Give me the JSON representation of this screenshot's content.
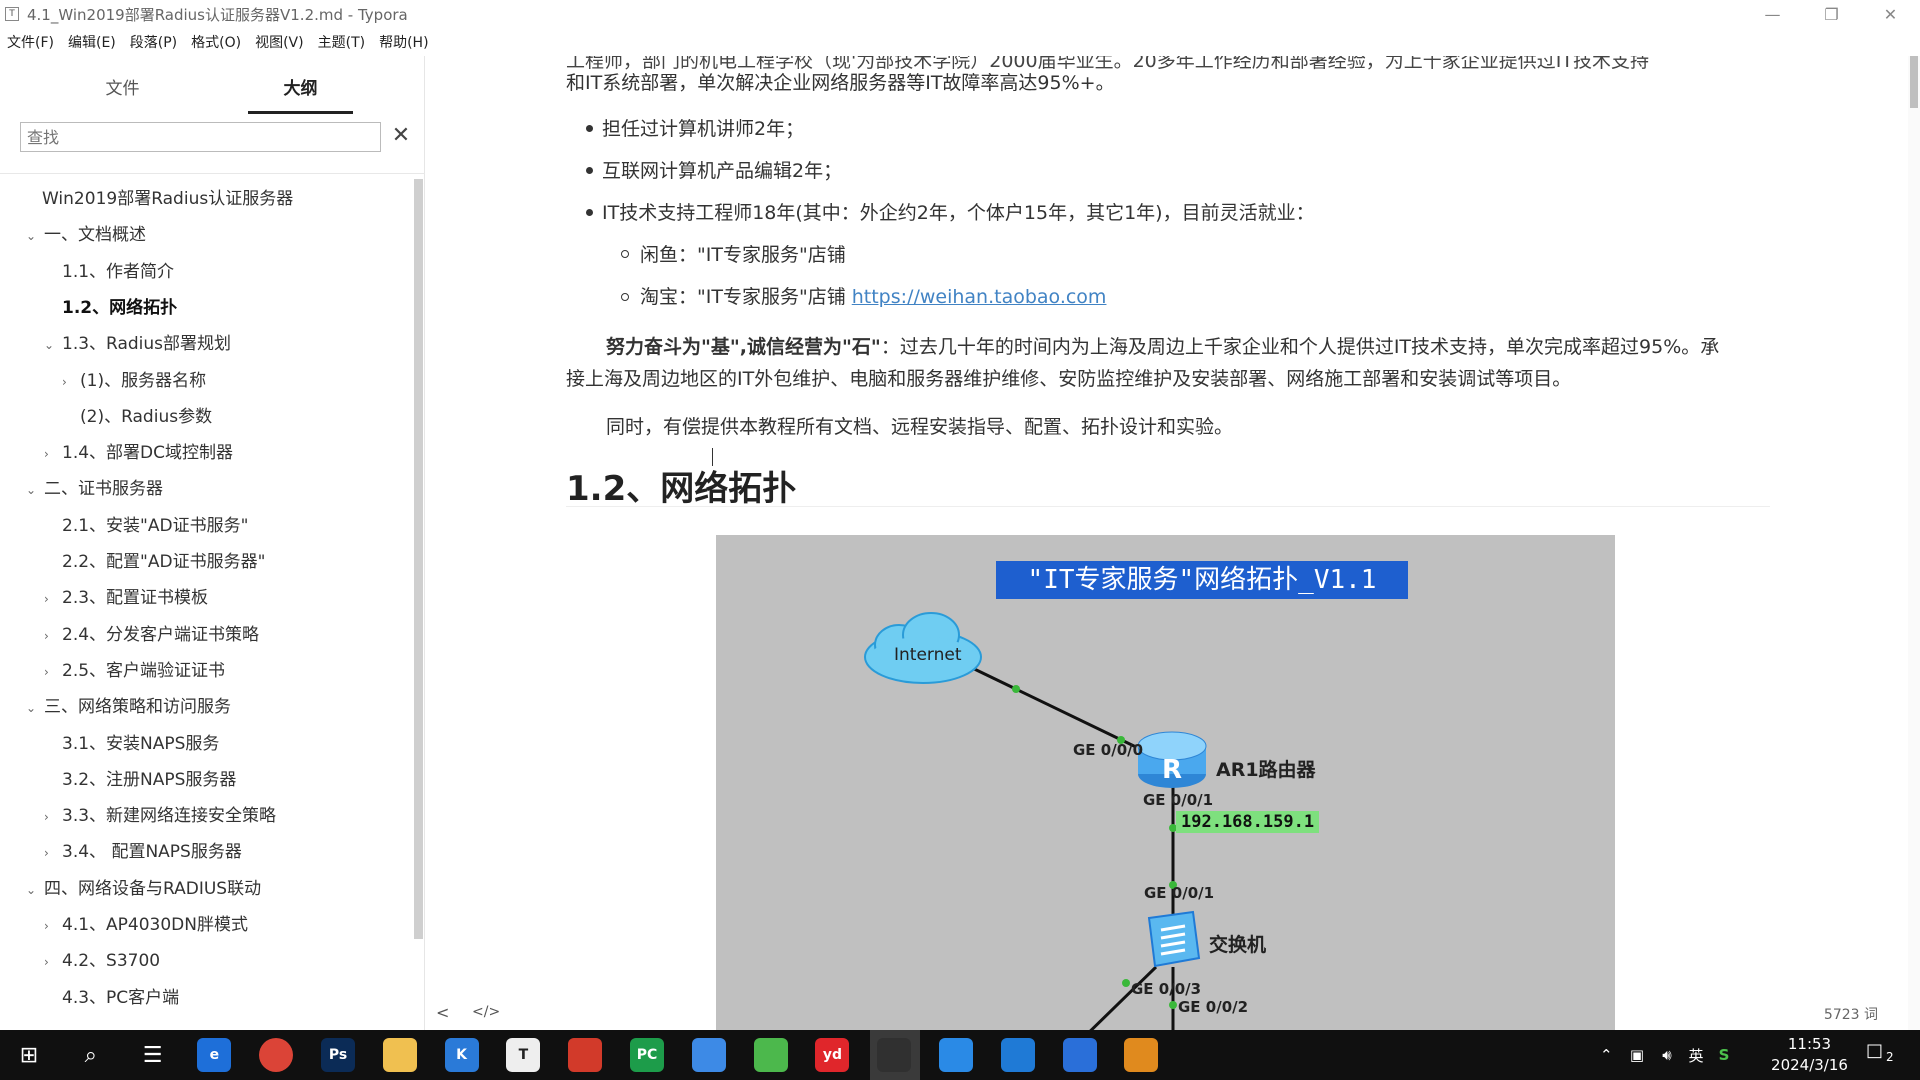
{
  "window": {
    "title": "4.1_Win2019部署Radius认证服务器V1.2.md - Typora",
    "app_icon": "T",
    "controls": [
      "minimize-icon",
      "restore-icon",
      "close-icon"
    ]
  },
  "menu": [
    "文件(F)",
    "编辑(E)",
    "段落(P)",
    "格式(O)",
    "视图(V)",
    "主题(T)",
    "帮助(H)"
  ],
  "sidebar": {
    "tabs": [
      {
        "label": "文件",
        "active": false
      },
      {
        "label": "大纲",
        "active": true
      }
    ],
    "search_placeholder": "查找",
    "outline": [
      {
        "label": "Win2019部署Radius认证服务器",
        "caret": "",
        "bold": false
      },
      {
        "label": "一、文档概述",
        "caret": "v",
        "bold": false
      },
      {
        "label": "1.1、作者简介",
        "caret": "",
        "bold": false
      },
      {
        "label": "1.2、网络拓扑",
        "caret": "",
        "bold": true
      },
      {
        "label": "1.3、Radius部署规划",
        "caret": "v",
        "bold": false
      },
      {
        "label": "(1)、服务器名称",
        "caret": ">",
        "bold": false
      },
      {
        "label": "(2)、Radius参数",
        "caret": "",
        "bold": false
      },
      {
        "label": "1.4、部署DC域控制器",
        "caret": ">",
        "bold": false
      },
      {
        "label": "二、证书服务器",
        "caret": "v",
        "bold": false
      },
      {
        "label": "2.1、安装\"AD证书服务\"",
        "caret": "",
        "bold": false
      },
      {
        "label": "2.2、配置\"AD证书服务器\"",
        "caret": "",
        "bold": false
      },
      {
        "label": "2.3、配置证书模板",
        "caret": ">",
        "bold": false
      },
      {
        "label": "2.4、分发客户端证书策略",
        "caret": ">",
        "bold": false
      },
      {
        "label": "2.5、客户端验证证书",
        "caret": ">",
        "bold": false
      },
      {
        "label": "三、网络策略和访问服务",
        "caret": "v",
        "bold": false
      },
      {
        "label": "3.1、安装NAPS服务",
        "caret": "",
        "bold": false
      },
      {
        "label": "3.2、注册NAPS服务器",
        "caret": "",
        "bold": false
      },
      {
        "label": "3.3、新建网络连接安全策略",
        "caret": ">",
        "bold": false
      },
      {
        "label": "3.4、 配置NAPS服务器",
        "caret": ">",
        "bold": false
      },
      {
        "label": "四、网络设备与RADIUS联动",
        "caret": "v",
        "bold": false
      },
      {
        "label": "4.1、AP4030DN胖模式",
        "caret": ">",
        "bold": false
      },
      {
        "label": "4.2、S3700",
        "caret": ">",
        "bold": false
      },
      {
        "label": "4.3、PC客户端",
        "caret": "",
        "bold": false
      }
    ]
  },
  "doc": {
    "top_partial": "工程师，部门的机电工程学校（现'为部技术学院）2000届毕业生。20多年工作经历和部署经验，为上千家企业提供过IT技术支持",
    "para1_end": "和IT系统部署，单次解决企业网络服务器等IT故障率高达95%+。",
    "bullets": [
      "担任过计算机讲师2年；",
      "互联网计算机产品编辑2年；",
      "IT技术支持工程师18年(其中：外企约2年，个体户15年，其它1年)，目前灵活就业："
    ],
    "sub_bullets": [
      {
        "text": "闲鱼：\"IT专家服务\"店铺",
        "link": ""
      },
      {
        "text": "淘宝：\"IT专家服务\"店铺 ",
        "link": "https://weihan.taobao.com"
      }
    ],
    "para2_bold": "努力奋斗为\"基\",诚信经营为\"石\"",
    "para2_rest": "：过去几十年的时间内为上海及周边上千家企业和个人提供过IT技术支持，单次完成率超过95%。承",
    "para2_line2": "接上海及周边地区的IT外包维护、电脑和服务器维护维修、安防监控维护及安装部署、网络施工部署和安装调试等项目。",
    "para3": "同时，有偿提供本教程所有文档、远程安装指导、配置、拓扑设计和实验。",
    "heading": "1.2、网络拓扑"
  },
  "diagram": {
    "title": "\"IT专家服务\"网络拓扑_V1.1",
    "internet": "Internet",
    "router_name": "AR1路由器",
    "router_port_in": "GE 0/0/0",
    "router_port_out": "GE 0/0/1",
    "router_ip": "192.168.159.1",
    "switch_port_in": "GE 0/0/1",
    "switch_name": "交换机",
    "switch_port_a": "GE 0/0/3",
    "switch_port_b": "GE 0/0/2"
  },
  "status": {
    "word_count": "5723 词",
    "nav_prev": "<",
    "source_toggle": "</>"
  },
  "taskbar": {
    "apps": [
      {
        "name": "start-icon",
        "glyph": "",
        "color": "#101010"
      },
      {
        "name": "search-icon",
        "glyph": "",
        "color": "#101010"
      },
      {
        "name": "task-view-icon",
        "glyph": "",
        "color": "#101010"
      },
      {
        "name": "edge-icon",
        "glyph": "e",
        "color": "#1e6fd9"
      },
      {
        "name": "chrome-icon",
        "glyph": "",
        "color": "#db4437"
      },
      {
        "name": "photoshop-icon",
        "glyph": "Ps",
        "color": "#0b2b56"
      },
      {
        "name": "file-explorer-icon",
        "glyph": "",
        "color": "#f0c050"
      },
      {
        "name": "k-app-icon",
        "glyph": "K",
        "color": "#2a7ad8"
      },
      {
        "name": "typora-icon",
        "glyph": "T",
        "color": "#eeeeee"
      },
      {
        "name": "snail-app-icon",
        "glyph": "",
        "color": "#d23a2a"
      },
      {
        "name": "pycharm-icon",
        "glyph": "PC",
        "color": "#1d9c4a"
      },
      {
        "name": "baidu-netdisk-icon",
        "glyph": "",
        "color": "#3d8ae6"
      },
      {
        "name": "green-app-icon",
        "glyph": "",
        "color": "#4cb84c"
      },
      {
        "name": "youdao-icon",
        "glyph": "yd",
        "color": "#e0262b"
      },
      {
        "name": "obs-icon",
        "glyph": "",
        "color": "#303030"
      },
      {
        "name": "network-tool-icon",
        "glyph": "",
        "color": "#2a8ae6"
      },
      {
        "name": "blue-bag-icon",
        "glyph": "",
        "color": "#1f7ad6"
      },
      {
        "name": "remote-desktop-icon",
        "glyph": "",
        "color": "#2a6fd9"
      },
      {
        "name": "vm-app-icon",
        "glyph": "",
        "color": "#e08a1e"
      }
    ],
    "tray": {
      "ime": "英",
      "time": "11:53",
      "date": "2024/3/16",
      "notifications": "2"
    }
  }
}
